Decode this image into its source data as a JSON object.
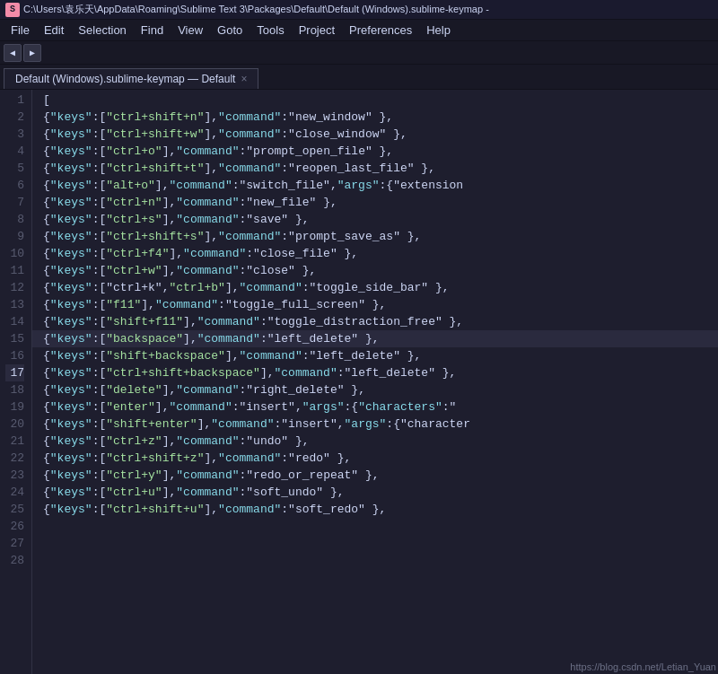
{
  "titlebar": {
    "icon": "ST",
    "text": "C:\\Users\\袁乐天\\AppData\\Roaming\\Sublime Text 3\\Packages\\Default\\Default (Windows).sublime-keymap -"
  },
  "menubar": {
    "items": [
      "File",
      "Edit",
      "Selection",
      "Find",
      "View",
      "Goto",
      "Tools",
      "Project",
      "Preferences",
      "Help"
    ]
  },
  "tab": {
    "label": "Default (Windows).sublime-keymap — Default",
    "close": "×"
  },
  "lines": [
    {
      "num": "1",
      "highlighted": false,
      "content": "["
    },
    {
      "num": "2",
      "highlighted": false,
      "content": "    { \"keys\": [\"ctrl+shift+n\"], \"command\": \"new_window\" },"
    },
    {
      "num": "3",
      "highlighted": false,
      "content": "    { \"keys\": [\"ctrl+shift+w\"], \"command\": \"close_window\" },"
    },
    {
      "num": "4",
      "highlighted": false,
      "content": "    { \"keys\": [\"ctrl+o\"], \"command\": \"prompt_open_file\" },"
    },
    {
      "num": "5",
      "highlighted": false,
      "content": "    { \"keys\": [\"ctrl+shift+t\"], \"command\": \"reopen_last_file\" },"
    },
    {
      "num": "6",
      "highlighted": false,
      "content": "    { \"keys\": [\"alt+o\"], \"command\": \"switch_file\", \"args\": {\"extension"
    },
    {
      "num": "7",
      "highlighted": false,
      "content": "    { \"keys\": [\"ctrl+n\"], \"command\": \"new_file\" },"
    },
    {
      "num": "8",
      "highlighted": false,
      "content": "    { \"keys\": [\"ctrl+s\"], \"command\": \"save\" },"
    },
    {
      "num": "9",
      "highlighted": false,
      "content": "    { \"keys\": [\"ctrl+shift+s\"], \"command\": \"prompt_save_as\" },"
    },
    {
      "num": "10",
      "highlighted": false,
      "content": "    { \"keys\": [\"ctrl+f4\"], \"command\": \"close_file\" },"
    },
    {
      "num": "11",
      "highlighted": false,
      "content": "    { \"keys\": [\"ctrl+w\"], \"command\": \"close\" },"
    },
    {
      "num": "12",
      "highlighted": false,
      "content": ""
    },
    {
      "num": "13",
      "highlighted": false,
      "content": "    { \"keys\": [\"ctrl+k\", \"ctrl+b\"], \"command\": \"toggle_side_bar\" },"
    },
    {
      "num": "14",
      "highlighted": false,
      "content": "    { \"keys\": [\"f11\"], \"command\": \"toggle_full_screen\" },"
    },
    {
      "num": "15",
      "highlighted": false,
      "content": "    { \"keys\": [\"shift+f11\"], \"command\": \"toggle_distraction_free\" },"
    },
    {
      "num": "16",
      "highlighted": false,
      "content": ""
    },
    {
      "num": "17",
      "highlighted": true,
      "content": "    { \"keys\": [\"backspace\"], \"command\": \"left_delete\" },"
    },
    {
      "num": "18",
      "highlighted": false,
      "content": "    { \"keys\": [\"shift+backspace\"], \"command\": \"left_delete\" },"
    },
    {
      "num": "19",
      "highlighted": false,
      "content": "    { \"keys\": [\"ctrl+shift+backspace\"], \"command\": \"left_delete\" },"
    },
    {
      "num": "20",
      "highlighted": false,
      "content": "    { \"keys\": [\"delete\"], \"command\": \"right_delete\" },"
    },
    {
      "num": "21",
      "highlighted": false,
      "content": "    { \"keys\": [\"enter\"], \"command\": \"insert\", \"args\": {\"characters\": \""
    },
    {
      "num": "22",
      "highlighted": false,
      "content": "    { \"keys\": [\"shift+enter\"], \"command\": \"insert\", \"args\": {\"character"
    },
    {
      "num": "23",
      "highlighted": false,
      "content": ""
    },
    {
      "num": "24",
      "highlighted": false,
      "content": "    { \"keys\": [\"ctrl+z\"], \"command\": \"undo\" },"
    },
    {
      "num": "25",
      "highlighted": false,
      "content": "    { \"keys\": [\"ctrl+shift+z\"], \"command\": \"redo\" },"
    },
    {
      "num": "26",
      "highlighted": false,
      "content": "    { \"keys\": [\"ctrl+y\"], \"command\": \"redo_or_repeat\" },"
    },
    {
      "num": "27",
      "highlighted": false,
      "content": "    { \"keys\": [\"ctrl+u\"], \"command\": \"soft_undo\" },"
    },
    {
      "num": "28",
      "highlighted": false,
      "content": "    { \"keys\": [\"ctrl+shift+u\"], \"command\": \"soft_redo\" },"
    }
  ],
  "watermark": "https://blog.csdn.net/Letian_Yuan"
}
